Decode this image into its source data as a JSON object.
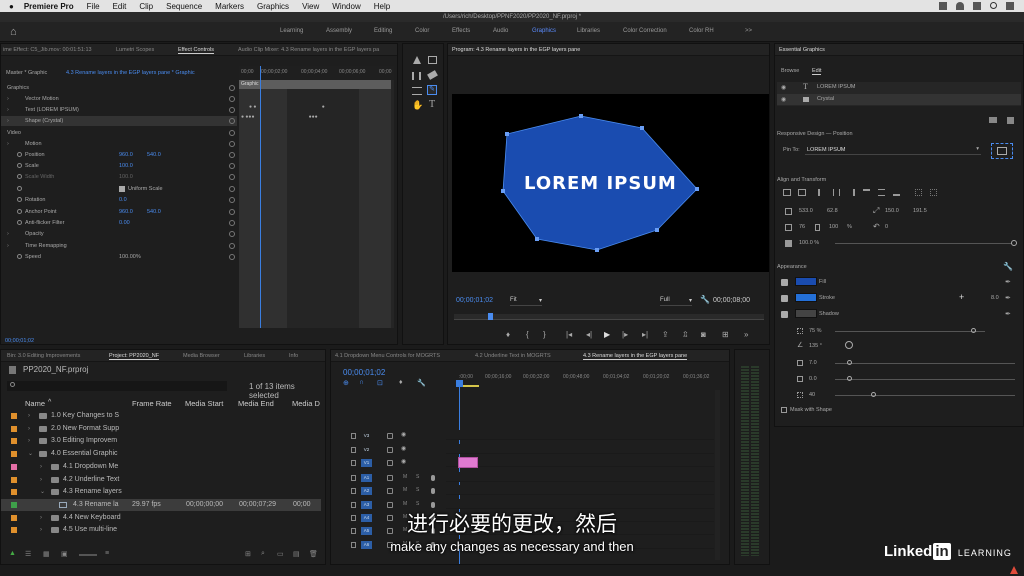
{
  "menubar": {
    "apple": "",
    "app": "Premiere Pro",
    "items": [
      "File",
      "Edit",
      "Clip",
      "Sequence",
      "Markers",
      "Graphics",
      "View",
      "Window",
      "Help"
    ]
  },
  "titlebar": {
    "path": "/Users/rich/Desktop/PPNF2020/PP2020_NF.prproj *"
  },
  "workspaces": {
    "items": [
      "Learning",
      "Assembly",
      "Editing",
      "Color",
      "Effects",
      "Audio",
      "Graphics",
      "Libraries",
      "Color Correction",
      "Color RH"
    ],
    "active": "Graphics",
    "more": ">>"
  },
  "effect_controls": {
    "tabs": [
      "ime Effect: C5_Jib.mov: 00:01:51:13",
      "Lumetri Scopes",
      "Effect Controls",
      "Audio Clip Mixer: 4.3 Rename layers in the EGP layers pa"
    ],
    "active_tab": "Effect Controls",
    "master": "Master * Graphic",
    "clip": "4.3 Rename layers in the EGP layers pane * Graphic",
    "ruler": [
      "00;00",
      "00;00;02;00",
      "00;00;04;00",
      "00;00;06;00",
      "00;00"
    ],
    "graphic_clip": "Graphic",
    "rows": [
      {
        "label": "Graphics",
        "indent": 0
      },
      {
        "label": "Vector Motion",
        "indent": 1
      },
      {
        "label": "Text (LOREM IPSUM)",
        "indent": 1
      },
      {
        "label": "Shape (Crystal)",
        "indent": 1,
        "selected": true
      },
      {
        "label": "Video",
        "indent": 0
      },
      {
        "label": "Motion",
        "indent": 1
      },
      {
        "label": "Position",
        "indent": 2,
        "v1": "960.0",
        "v2": "540.0"
      },
      {
        "label": "Scale",
        "indent": 2,
        "v1": "100.0"
      },
      {
        "label": "Scale Width",
        "indent": 2,
        "v1": "100.0",
        "dim": true
      },
      {
        "label": "Uniform Scale",
        "indent": 2,
        "check": true
      },
      {
        "label": "Rotation",
        "indent": 2,
        "v1": "0.0"
      },
      {
        "label": "Anchor Point",
        "indent": 2,
        "v1": "960.0",
        "v2": "540.0"
      },
      {
        "label": "Anti-flicker Filter",
        "indent": 2,
        "v1": "0.00"
      },
      {
        "label": "Opacity",
        "indent": 1
      },
      {
        "label": "Time Remapping",
        "indent": 1
      },
      {
        "label": "Speed",
        "indent": 2,
        "v1": "100.00%"
      }
    ],
    "timecode": "00;00;01;02"
  },
  "program": {
    "title": "Program: 4.3 Rename layers in the EGP layers pane",
    "graphic_text": "LOREM IPSUM",
    "timecode": "00;00;01;02",
    "fit": "Fit",
    "quality": "Full",
    "duration": "00;00;08;00"
  },
  "egp": {
    "title": "Essential Graphics",
    "tabs": [
      "Browse",
      "Edit"
    ],
    "active_tab": "Edit",
    "layers": [
      "LOREM IPSUM",
      "Crystal"
    ],
    "responsive_heading": "Responsive Design — Position",
    "pin_to_label": "Pin To:",
    "pin_to_value": "LOREM IPSUM",
    "align_heading": "Align and Transform",
    "pos_x": "533.0",
    "pos_y": "62.8",
    "anchor_x": "150.0",
    "anchor_y": "191.5",
    "scale": "76",
    "scale_pct": "100",
    "rotation": "0",
    "opacity": "100.0 %",
    "appearance_heading": "Appearance",
    "fill_label": "Fill",
    "stroke_label": "Stroke",
    "stroke_value": "8.0",
    "shadow_label": "Shadow",
    "shadow_params": [
      "75 %",
      "135 °",
      "7.0",
      "0.0",
      "40"
    ],
    "mask_label": "Mask with Shape",
    "fill_color": "#1a4cb0",
    "stroke_color": "#2470d8"
  },
  "project": {
    "tabs": [
      "Bin: 3.0 Editing Improvements",
      "Project: PP2020_NF",
      "Media Browser",
      "Libraries",
      "Info"
    ],
    "active_tab": "Project: PP2020_NF",
    "filename": "PP2020_NF.prproj",
    "selected_count": "1 of 13 items selected",
    "columns": [
      "Name",
      "Frame Rate",
      "Media Start",
      "Media End",
      "Media D"
    ],
    "rows": [
      {
        "name": "1.0 Key Changes to S",
        "color": "#e0902c",
        "level": 0
      },
      {
        "name": "2.0 New Format Supp",
        "color": "#e0902c",
        "level": 0
      },
      {
        "name": "3.0 Editing Improvem",
        "color": "#e0902c",
        "level": 0
      },
      {
        "name": "4.0 Essential Graphic",
        "color": "#e0902c",
        "level": 0,
        "open": true
      },
      {
        "name": "4.1 Dropdown Me",
        "color": "#e46fa6",
        "level": 1
      },
      {
        "name": "4.2 Underline Text",
        "color": "#e0902c",
        "level": 1
      },
      {
        "name": "4.3 Rename layers",
        "color": "#e0902c",
        "level": 1,
        "open": true
      },
      {
        "name": "4.3 Rename la",
        "color": "#3ea04a",
        "level": 2,
        "fps": "29.97 fps",
        "start": "00;00;00;00",
        "end": "00;00;07;29",
        "dur": "00;00",
        "selected": true
      },
      {
        "name": "4.4 New Keyboard",
        "color": "#e0902c",
        "level": 1
      },
      {
        "name": "4.5 Use multi-line",
        "color": "#e0902c",
        "level": 1
      }
    ]
  },
  "timeline": {
    "tabs": [
      "4.1 Dropdown Menu Controls for MOGRTS",
      "4.2 Underline Text in MOGRTS",
      "4.3 Rename layers in the EGP layers pane"
    ],
    "active_tab": "4.3 Rename layers in the EGP layers pane",
    "timecode": "00;00;01;02",
    "ruler": [
      ":00;00",
      "00;00;16;00",
      "00;00;32;00",
      "00;00;48;00",
      "00;01;04;02",
      "00;01;20;02",
      "00;01;36;02"
    ],
    "video_tracks": [
      "V3",
      "V2",
      "V1"
    ],
    "audio_tracks": [
      "A1",
      "A2",
      "A3",
      "A4",
      "A5",
      "A6"
    ]
  },
  "subtitles": {
    "zh": "进行必要的更改，然后",
    "en": "make any changes as necessary and then"
  },
  "watermark": {
    "brand": "Linked",
    "in": "in",
    "learning": "LEARNING"
  }
}
